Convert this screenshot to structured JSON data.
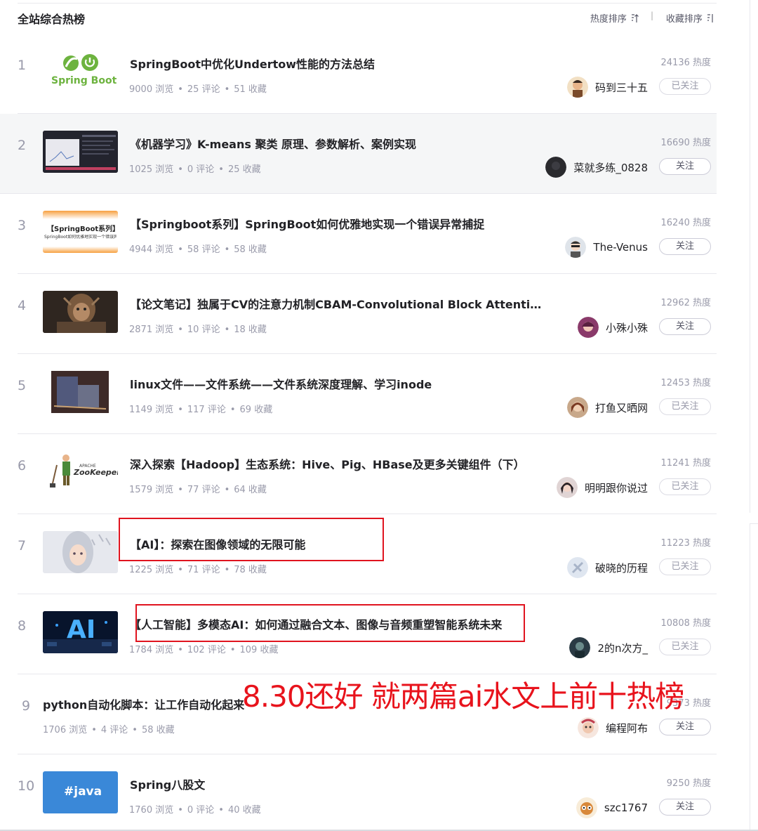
{
  "header": {
    "title": "全站综合热榜",
    "sort_hot": "热度排序",
    "sort_fav": "收藏排序",
    "separator": "|"
  },
  "articles": [
    {
      "rank": "1",
      "title": "SpringBoot中优化Undertow性能的方法总结",
      "views": "9000 浏览",
      "comments": "25 评论",
      "favorites": "51 收藏",
      "heat": "24136 热度",
      "author": "码到三十五",
      "follow": "已关注",
      "thumb_text": "Spring Boot"
    },
    {
      "rank": "2",
      "title": "《机器学习》K-means 聚类 原理、参数解析、案例实现",
      "views": "1025 浏览",
      "comments": "0 评论",
      "favorites": "25 收藏",
      "heat": "16690 热度",
      "author": "菜就多练_0828",
      "follow": "关注"
    },
    {
      "rank": "3",
      "title": "【Springboot系列】SpringBoot如何优雅地实现一个错误异常捕捉",
      "views": "4944 浏览",
      "comments": "58 评论",
      "favorites": "58 收藏",
      "heat": "16240 热度",
      "author": "The-Venus",
      "follow": "关注",
      "thumb_text": "【SpringBoot系列】",
      "thumb_sub": "SpringBoot如何优雅地实现一个错误异常捕捉"
    },
    {
      "rank": "4",
      "title": "【论文笔记】独属于CV的注意力机制CBAM-Convolutional Block Attention Module",
      "views": "2871 浏览",
      "comments": "10 评论",
      "favorites": "18 收藏",
      "heat": "12962 热度",
      "author": "小殊小殊",
      "follow": "关注"
    },
    {
      "rank": "5",
      "title": "linux文件——文件系统——文件系统深度理解、学习inode",
      "views": "1149 浏览",
      "comments": "117 评论",
      "favorites": "69 收藏",
      "heat": "12453 热度",
      "author": "打鱼又晒网",
      "follow": "已关注"
    },
    {
      "rank": "6",
      "title": "深入探索【Hadoop】生态系统：Hive、Pig、HBase及更多关键组件（下）",
      "views": "1579 浏览",
      "comments": "77 评论",
      "favorites": "64 收藏",
      "heat": "11241 热度",
      "author": "明明跟你说过",
      "follow": "已关注",
      "thumb_text": "ZooKeeper",
      "thumb_sub": "APACHE"
    },
    {
      "rank": "7",
      "title": "【AI】：探索在图像领域的无限可能",
      "views": "1225 浏览",
      "comments": "71 评论",
      "favorites": "78 收藏",
      "heat": "11223 热度",
      "author": "破晓的历程",
      "follow": "已关注"
    },
    {
      "rank": "8",
      "title": "【人工智能】多模态AI：如何通过融合文本、图像与音频重塑智能系统未来",
      "views": "1784 浏览",
      "comments": "102 评论",
      "favorites": "109 收藏",
      "heat": "10808 热度",
      "author": "2的n次方_",
      "follow": "已关注",
      "thumb_text": "AI"
    },
    {
      "rank": "9",
      "title": "python自动化脚本：让工作自动化起来",
      "views": "1706 浏览",
      "comments": "4 评论",
      "favorites": "58 收藏",
      "heat": "9373 热度",
      "author": "编程阿布",
      "follow": "关注"
    },
    {
      "rank": "10",
      "title": "Spring八股文",
      "views": "1760 浏览",
      "comments": "0 评论",
      "favorites": "40 收藏",
      "heat": "9250 热度",
      "author": "szc1767",
      "follow": "关注",
      "thumb_text": "#java"
    }
  ],
  "annotation": "8.30还好 就两篇ai水文上前十热榜",
  "colors": {
    "accent_red": "#e8131c",
    "text": "#222226",
    "muted": "#999aaa"
  }
}
